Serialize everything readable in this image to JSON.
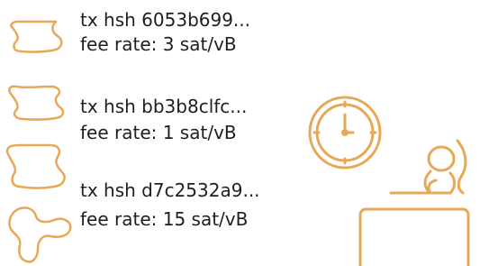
{
  "colors": {
    "accent": "#E8A857",
    "text": "#1f1f1f"
  },
  "transactions": [
    {
      "hash_line": "tx hsh 6053b699...",
      "fee_line": "fee rate: 3 sat/vB",
      "icon": "tx-blob-icon"
    },
    {
      "hash_line": "tx hsh bb3b8clfc...",
      "fee_line": "fee rate: 1 sat/vB",
      "icon": "tx-blob-icon"
    },
    {
      "hash_line": "tx hsh d7c2532a9...",
      "fee_line": "fee rate: 15 sat/vB",
      "icon": "tx-blob-icon"
    }
  ],
  "illustration": {
    "clock_icon": "clock-icon",
    "person_icon": "person-at-desk-icon"
  }
}
